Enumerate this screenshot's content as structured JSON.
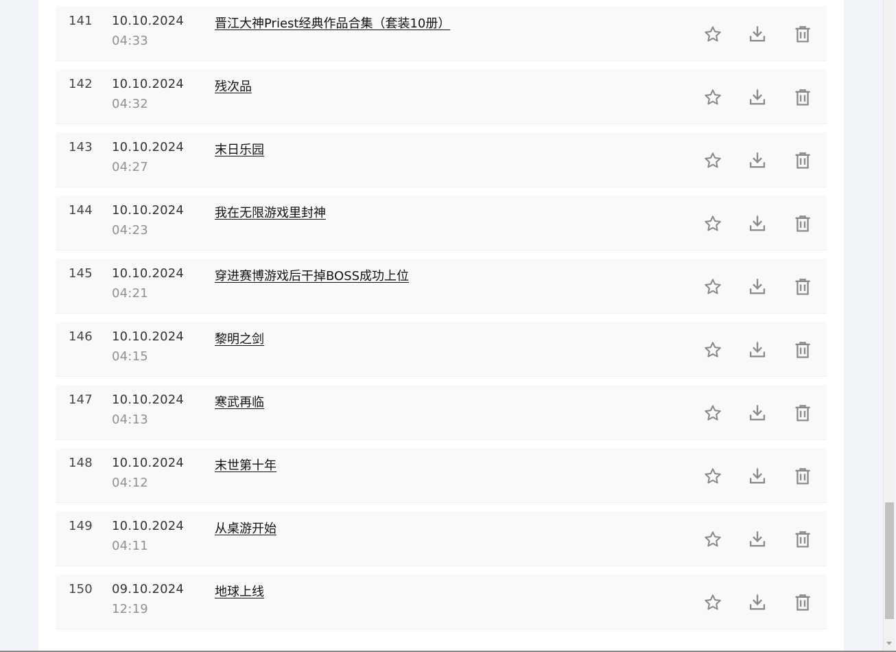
{
  "colors": {
    "page_bg": "#f1f4f8",
    "row_bg": "#f9f9f9",
    "icon": "#8a8a8a",
    "date_text": "#333333",
    "time_text": "#909090"
  },
  "action_icons": [
    "star-icon",
    "download-icon",
    "trash-icon"
  ],
  "items": [
    {
      "num": "141",
      "date": "10.10.2024",
      "time": "04:33",
      "title": "晋江大神Priest经典作品合集（套装10册）"
    },
    {
      "num": "142",
      "date": "10.10.2024",
      "time": "04:32",
      "title": "残次品"
    },
    {
      "num": "143",
      "date": "10.10.2024",
      "time": "04:27",
      "title": "末日乐园"
    },
    {
      "num": "144",
      "date": "10.10.2024",
      "time": "04:23",
      "title": "我在无限游戏里封神"
    },
    {
      "num": "145",
      "date": "10.10.2024",
      "time": "04:21",
      "title": "穿进赛博游戏后干掉BOSS成功上位"
    },
    {
      "num": "146",
      "date": "10.10.2024",
      "time": "04:15",
      "title": "黎明之剑"
    },
    {
      "num": "147",
      "date": "10.10.2024",
      "time": "04:13",
      "title": "寒武再临"
    },
    {
      "num": "148",
      "date": "10.10.2024",
      "time": "04:12",
      "title": "末世第十年"
    },
    {
      "num": "149",
      "date": "10.10.2024",
      "time": "04:11",
      "title": "从桌游开始"
    },
    {
      "num": "150",
      "date": "09.10.2024",
      "time": "12:19",
      "title": "地球上线"
    }
  ]
}
